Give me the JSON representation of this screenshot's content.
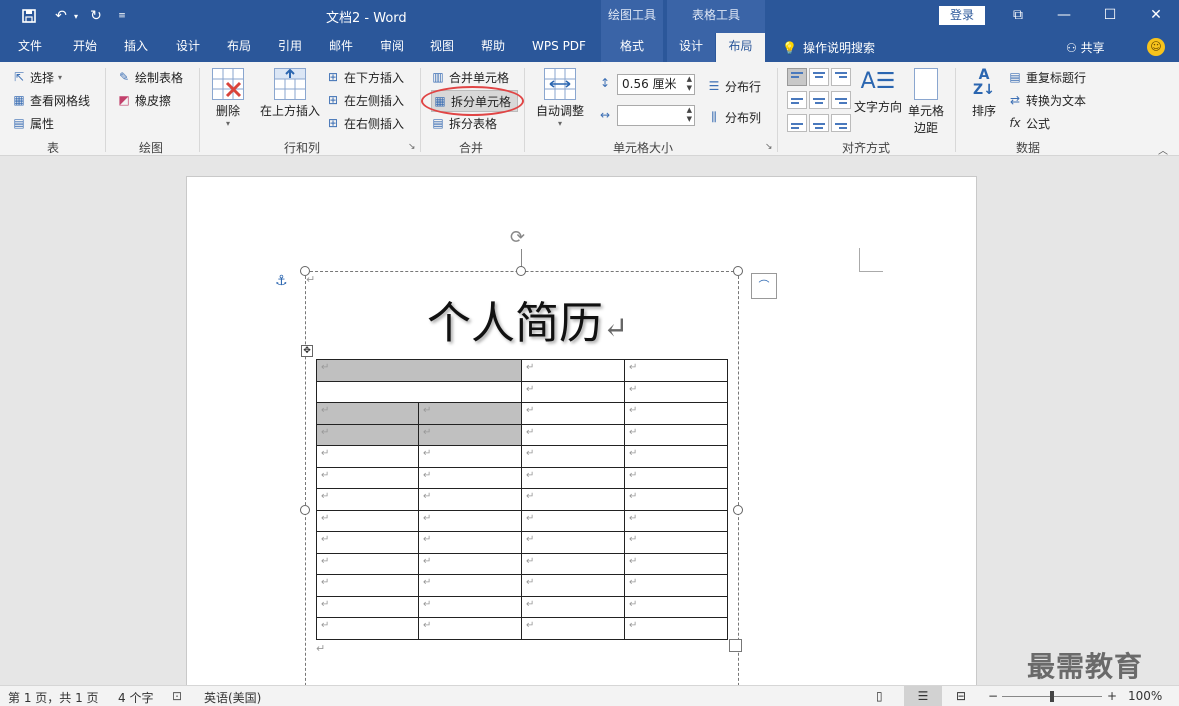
{
  "titlebar": {
    "doc_title": "文档2  -  Word",
    "context_drawing": "绘图工具",
    "context_table": "表格工具",
    "login": "登录"
  },
  "tabs": [
    "文件",
    "开始",
    "插入",
    "设计",
    "布局",
    "引用",
    "邮件",
    "审阅",
    "视图",
    "帮助",
    "WPS PDF",
    "格式",
    "设计",
    "布局"
  ],
  "tell_me": "操作说明搜索",
  "share": "共享",
  "ribbon": {
    "table_group": {
      "label": "表",
      "select": "选择",
      "view_gridlines": "查看网格线",
      "properties": "属性"
    },
    "draw_group": {
      "label": "绘图",
      "draw_table": "绘制表格",
      "eraser": "橡皮擦"
    },
    "rows_cols_group": {
      "label": "行和列",
      "delete": "删除",
      "insert_above": "在上方插入",
      "insert_below": "在下方插入",
      "insert_left": "在左侧插入",
      "insert_right": "在右侧插入"
    },
    "merge_group": {
      "label": "合并",
      "merge_cells": "合并单元格",
      "split_cells": "拆分单元格",
      "split_table": "拆分表格"
    },
    "cell_size_group": {
      "label": "单元格大小",
      "autofit": "自动调整",
      "height_value": "0.56 厘米",
      "width_value": "",
      "distribute_rows": "分布行",
      "distribute_cols": "分布列"
    },
    "alignment_group": {
      "label": "对齐方式",
      "text_direction": "文字方向",
      "cell_margins_1": "单元格",
      "cell_margins_2": "边距"
    },
    "data_group": {
      "label": "数据",
      "sort": "排序",
      "repeat_header": "重复标题行",
      "convert_to_text": "转换为文本",
      "formula": "公式"
    }
  },
  "document": {
    "heading": "个人简历",
    "para_mark": "↵",
    "table_rows": 13,
    "table_cols": 4
  },
  "status": {
    "page": "第 1 页，共 1 页",
    "words": "4 个字",
    "language": "英语(美国)",
    "zoom": "100%",
    "zoom_minus": "−",
    "zoom_plus": "+"
  },
  "watermark": "最需教育"
}
